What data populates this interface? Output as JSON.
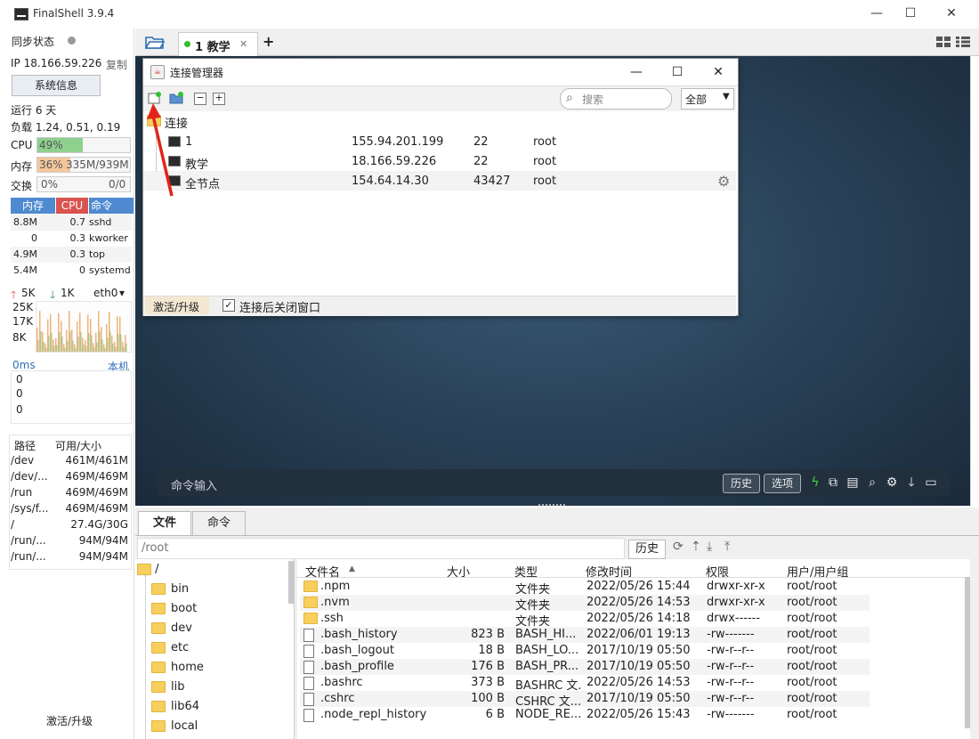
{
  "window": {
    "title": "FinalShell 3.9.4",
    "min": "—",
    "max": "☐",
    "close": "✕"
  },
  "left": {
    "sync_label": "同步状态",
    "ip": "IP 18.166.59.226",
    "copy": "复制",
    "sysinfo_btn": "系统信息",
    "uptime": "运行 6 天",
    "load": "负载 1.24, 0.51, 0.19",
    "cpu_label": "CPU",
    "cpu_value": "49%",
    "cpu_pct": 49,
    "mem_label": "内存",
    "mem_value": "36%",
    "mem_detail": "335M/939M",
    "mem_pct": 36,
    "swap_label": "交换",
    "swap_value": "0%",
    "swap_detail": "0/0",
    "proc_headers": [
      "内存",
      "CPU",
      "命令"
    ],
    "processes": [
      {
        "mem": "8.8M",
        "cpu": "0.7",
        "cmd": "sshd"
      },
      {
        "mem": "0",
        "cpu": "0.3",
        "cmd": "kworker"
      },
      {
        "mem": "4.9M",
        "cpu": "0.3",
        "cmd": "top"
      },
      {
        "mem": "5.4M",
        "cpu": "0",
        "cmd": "systemd"
      }
    ],
    "net_up": "5K",
    "net_down": "1K",
    "net_if": "eth0",
    "net_scale": [
      "25K",
      "17K",
      "8K"
    ],
    "ping_label": "0ms",
    "ping_host": "本机",
    "ping_vals": [
      "0",
      "0",
      "0"
    ],
    "disk_headers": [
      "路径",
      "可用/大小"
    ],
    "disks": [
      {
        "path": "/dev",
        "size": "461M/461M"
      },
      {
        "path": "/dev/...",
        "size": "469M/469M"
      },
      {
        "path": "/run",
        "size": "469M/469M"
      },
      {
        "path": "/sys/f...",
        "size": "469M/469M"
      },
      {
        "path": "/",
        "size": "27.4G/30G"
      },
      {
        "path": "/run/...",
        "size": "94M/94M"
      },
      {
        "path": "/run/...",
        "size": "94M/94M"
      }
    ],
    "activate": "激活/升级"
  },
  "tabs": {
    "active": "1 教学",
    "close": "✕",
    "add": "+"
  },
  "terminal": {
    "cmd_placeholder": "命令输入",
    "history_btn": "历史",
    "options_btn": "选项"
  },
  "dialog": {
    "title": "连接管理器",
    "search_placeholder": "搜索",
    "filter": "全部",
    "root": "连接",
    "connections": [
      {
        "name": "1",
        "host": "155.94.201.199",
        "port": "22",
        "user": "root"
      },
      {
        "name": "教学",
        "host": "18.166.59.226",
        "port": "22",
        "user": "root"
      },
      {
        "name": "全节点",
        "host": "154.64.14.30",
        "port": "43427",
        "user": "root"
      }
    ],
    "activate": "激活/升级",
    "close_after": "连接后关闭窗口",
    "close_after_checked": true
  },
  "files": {
    "tabs": [
      "文件",
      "命令"
    ],
    "path": "/root",
    "history_btn": "历史",
    "tree_root": "/",
    "tree": [
      "bin",
      "boot",
      "dev",
      "etc",
      "home",
      "lib",
      "lib64",
      "local"
    ],
    "columns": [
      "文件名",
      "大小",
      "类型",
      "修改时间",
      "权限",
      "用户/用户组"
    ],
    "rows": [
      {
        "name": ".npm",
        "size": "",
        "type": "文件夹",
        "time": "2022/05/26 15:44",
        "perm": "drwxr-xr-x",
        "owner": "root/root",
        "dir": true
      },
      {
        "name": ".nvm",
        "size": "",
        "type": "文件夹",
        "time": "2022/05/26 14:53",
        "perm": "drwxr-xr-x",
        "owner": "root/root",
        "dir": true
      },
      {
        "name": ".ssh",
        "size": "",
        "type": "文件夹",
        "time": "2022/05/26 14:18",
        "perm": "drwx------",
        "owner": "root/root",
        "dir": true
      },
      {
        "name": ".bash_history",
        "size": "823 B",
        "type": "BASH_HI...",
        "time": "2022/06/01 19:13",
        "perm": "-rw-------",
        "owner": "root/root",
        "dir": false
      },
      {
        "name": ".bash_logout",
        "size": "18 B",
        "type": "BASH_LO...",
        "time": "2017/10/19 05:50",
        "perm": "-rw-r--r--",
        "owner": "root/root",
        "dir": false
      },
      {
        "name": ".bash_profile",
        "size": "176 B",
        "type": "BASH_PR...",
        "time": "2017/10/19 05:50",
        "perm": "-rw-r--r--",
        "owner": "root/root",
        "dir": false
      },
      {
        "name": ".bashrc",
        "size": "373 B",
        "type": "BASHRC 文...",
        "time": "2022/05/26 14:53",
        "perm": "-rw-r--r--",
        "owner": "root/root",
        "dir": false
      },
      {
        "name": ".cshrc",
        "size": "100 B",
        "type": "CSHRC 文...",
        "time": "2017/10/19 05:50",
        "perm": "-rw-r--r--",
        "owner": "root/root",
        "dir": false
      },
      {
        "name": ".node_repl_history",
        "size": "6 B",
        "type": "NODE_RE...",
        "time": "2022/05/26 15:43",
        "perm": "-rw-------",
        "owner": "root/root",
        "dir": false
      }
    ]
  },
  "colors": {
    "accent": "#2f6fb5",
    "cpu_fill": "#8fd08f",
    "mem_fill": "#f3c79c",
    "arrow": "#e0251b"
  }
}
